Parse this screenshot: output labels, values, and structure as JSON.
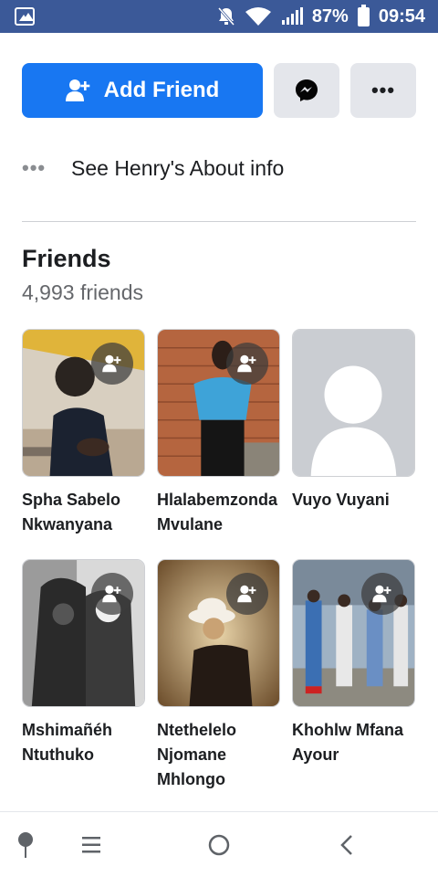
{
  "status_bar": {
    "battery": "87%",
    "time": "09:54",
    "icons": [
      "image-notification-icon",
      "mute-icon",
      "wifi-icon",
      "signal-icon",
      "battery-icon"
    ]
  },
  "actions": {
    "add_friend_label": "Add Friend",
    "messenger_icon": "messenger-icon",
    "more_icon": "more-dots-icon"
  },
  "about": {
    "label": "See Henry's About info"
  },
  "friends": {
    "title": "Friends",
    "count": "4,993 friends",
    "items": [
      {
        "name": "Spha Sabelo\nNkwanyana"
      },
      {
        "name": "Hlalabemzonda\nMvulane"
      },
      {
        "name": "Vuyo Vuyani"
      },
      {
        "name": "Mshimañéh\nNtuthuko"
      },
      {
        "name": "Ntethelelo\nNjomane\nMhlongo"
      },
      {
        "name": "Khohlw Mfana\nAyour"
      }
    ]
  },
  "nav": {
    "icons": [
      "accessibility-icon",
      "recent-apps-icon",
      "home-icon",
      "back-icon"
    ]
  },
  "colors": {
    "status_bar": "#3b5998",
    "primary_button": "#1877f2",
    "secondary_button": "#e4e6eb",
    "secondary_text": "#65676b"
  }
}
